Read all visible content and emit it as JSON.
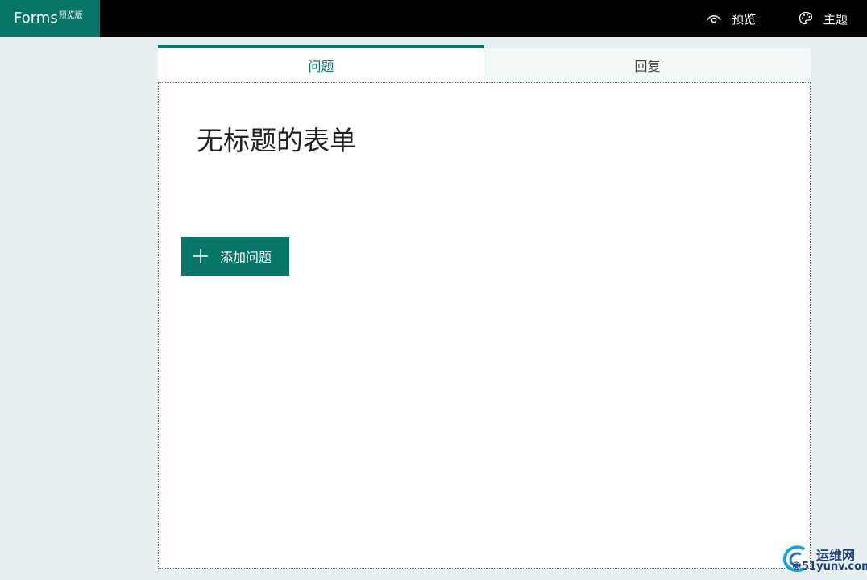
{
  "header": {
    "brand": "Forms",
    "brand_tag": "预览版",
    "preview_label": "预览",
    "theme_label": "主题",
    "brand_color": "#077568"
  },
  "tabs": [
    {
      "label": "问题",
      "active": true
    },
    {
      "label": "回复",
      "active": false
    }
  ],
  "form": {
    "title": "无标题的表单",
    "add_question_label": "添加问题"
  },
  "icons": {
    "preview": "eye-icon",
    "theme": "palette-icon",
    "add": "plus-icon"
  },
  "watermark": {
    "line1": "运维网",
    "line2": "©51yunv.com"
  }
}
